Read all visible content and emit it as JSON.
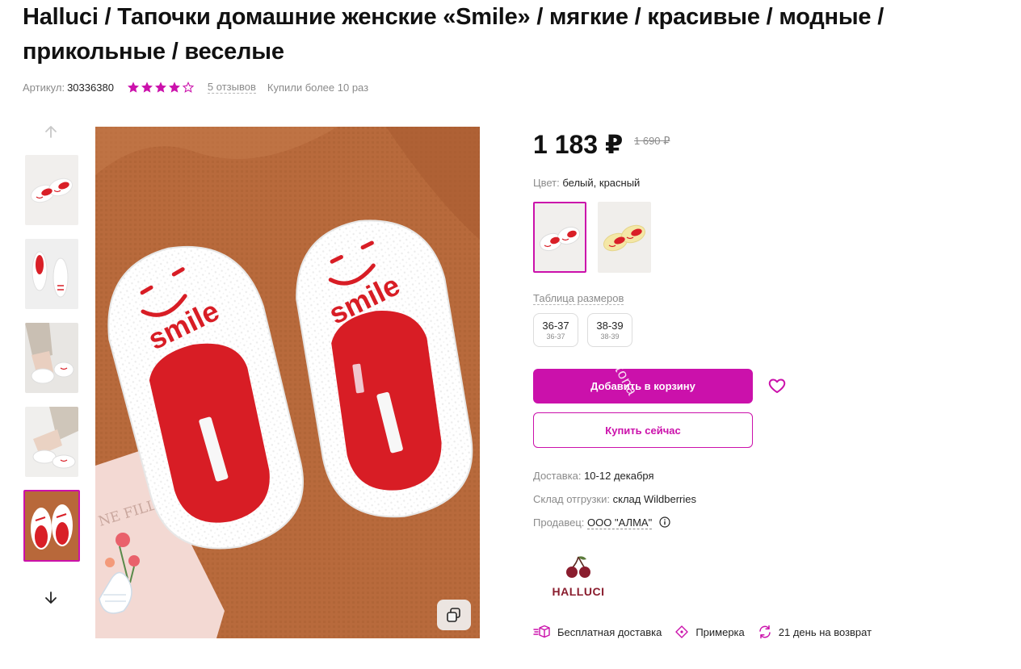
{
  "product": {
    "title": "Halluci / Тапочки домашние женские «Smile» / мягкие / красивые / модные / прикольные / веселые",
    "sku_label": "Артикул:",
    "sku": "30336380",
    "rating": 4,
    "reviews": "5 отзывов",
    "bought": "Купили более 10 раз"
  },
  "gallery": {
    "thumbs": [
      {
        "name": "thumb-1",
        "active": false
      },
      {
        "name": "thumb-2",
        "active": false
      },
      {
        "name": "thumb-3",
        "active": false
      },
      {
        "name": "thumb-4",
        "active": false
      },
      {
        "name": "thumb-5",
        "active": true
      }
    ],
    "main_image": "white-smile-slippers",
    "card_text": "NE FILLE",
    "slipper_text": "smile",
    "up_icon": "arrow-up-icon",
    "down_icon": "arrow-down-icon",
    "zoom_icon": "copy-icon"
  },
  "pricing": {
    "price": "1 183 ₽",
    "old_price": "1 690 ₽"
  },
  "color": {
    "label": "Цвет:",
    "value": "белый, красный",
    "options": [
      "white-red",
      "yellow-red"
    ]
  },
  "sizes": {
    "table_label": "Таблица размеров",
    "items": [
      {
        "size": "36-37",
        "ru": "36-37"
      },
      {
        "size": "38-39",
        "ru": "38-39"
      }
    ]
  },
  "actions": {
    "add_to_cart": "Добавить в корзину",
    "buy_now": "Купить сейчас",
    "favorite_icon": "heart-icon"
  },
  "watermark": "ptona",
  "delivery": {
    "label": "Доставка:",
    "value": "10-12 декабря"
  },
  "warehouse": {
    "label": "Склад отгрузки:",
    "value": "склад Wildberries"
  },
  "seller": {
    "label": "Продавец:",
    "value": "ООО \"АЛМА\""
  },
  "brand": {
    "name": "HALLUCI"
  },
  "features": [
    {
      "icon": "box-icon",
      "label": "Бесплатная доставка"
    },
    {
      "icon": "hanger-icon",
      "label": "Примерка"
    },
    {
      "icon": "refresh-icon",
      "label": "21 день на возврат"
    }
  ],
  "colors": {
    "accent": "#cb11ab",
    "star": "#cb11ab",
    "brand": "#8a1d2e"
  }
}
